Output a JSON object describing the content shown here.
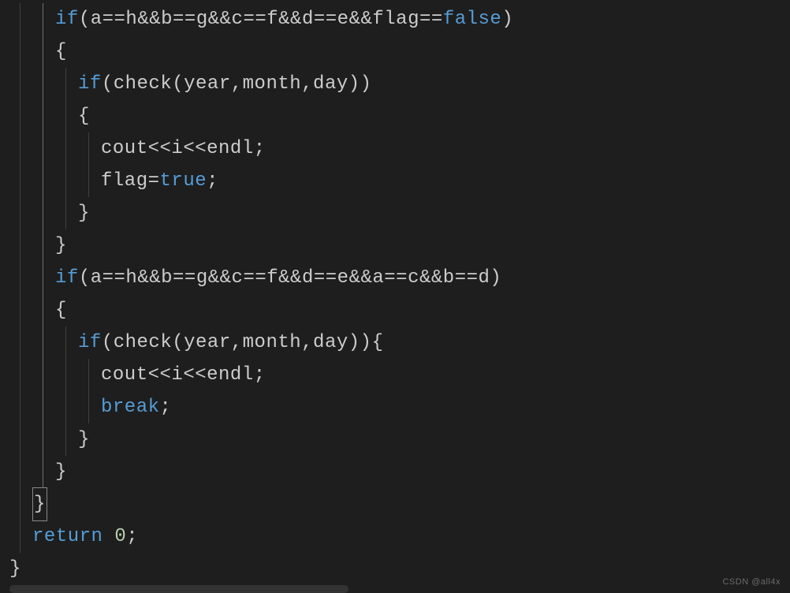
{
  "code": {
    "lines": [
      {
        "indent": 4,
        "tokens": [
          {
            "t": "if",
            "c": "keyword"
          },
          {
            "t": "(a==h&&b==g&&c==f&&d==e&&flag==",
            "c": "text"
          },
          {
            "t": "false",
            "c": "bool"
          },
          {
            "t": ")",
            "c": "text"
          }
        ]
      },
      {
        "indent": 4,
        "tokens": [
          {
            "t": "{",
            "c": "text"
          }
        ]
      },
      {
        "indent": 6,
        "tokens": [
          {
            "t": "if",
            "c": "keyword"
          },
          {
            "t": "(check(year,month,day))",
            "c": "text"
          }
        ]
      },
      {
        "indent": 6,
        "tokens": [
          {
            "t": "{",
            "c": "text"
          }
        ]
      },
      {
        "indent": 8,
        "tokens": [
          {
            "t": "cout<<i<<endl;",
            "c": "text"
          }
        ]
      },
      {
        "indent": 8,
        "tokens": [
          {
            "t": "flag=",
            "c": "text"
          },
          {
            "t": "true",
            "c": "bool"
          },
          {
            "t": ";",
            "c": "text"
          }
        ]
      },
      {
        "indent": 6,
        "tokens": [
          {
            "t": "}",
            "c": "text"
          }
        ]
      },
      {
        "indent": 4,
        "tokens": [
          {
            "t": "}",
            "c": "text"
          }
        ]
      },
      {
        "indent": 4,
        "tokens": [
          {
            "t": "if",
            "c": "keyword"
          },
          {
            "t": "(a==h&&b==g&&c==f&&d==e&&a==c&&b==d)",
            "c": "text"
          }
        ]
      },
      {
        "indent": 4,
        "tokens": [
          {
            "t": "{",
            "c": "text"
          }
        ]
      },
      {
        "indent": 6,
        "tokens": [
          {
            "t": "if",
            "c": "keyword"
          },
          {
            "t": "(check(year,month,day)){",
            "c": "text"
          }
        ]
      },
      {
        "indent": 8,
        "tokens": [
          {
            "t": "cout<<i<<endl;",
            "c": "text"
          }
        ]
      },
      {
        "indent": 8,
        "tokens": [
          {
            "t": "break",
            "c": "keyword"
          },
          {
            "t": ";",
            "c": "text"
          }
        ]
      },
      {
        "indent": 6,
        "tokens": [
          {
            "t": "}",
            "c": "text"
          }
        ]
      },
      {
        "indent": 4,
        "tokens": [
          {
            "t": "}",
            "c": "text"
          }
        ]
      },
      {
        "indent": 2,
        "tokens": [
          {
            "t": "}",
            "c": "text",
            "bracket": true
          }
        ]
      },
      {
        "indent": 2,
        "tokens": [
          {
            "t": "return",
            "c": "keyword"
          },
          {
            "t": " ",
            "c": "text"
          },
          {
            "t": "0",
            "c": "num"
          },
          {
            "t": ";",
            "c": "text"
          }
        ]
      },
      {
        "indent": 0,
        "tokens": [
          {
            "t": "}",
            "c": "text"
          }
        ]
      }
    ]
  },
  "watermark": "CSDN @all4x",
  "indentGuides": {
    "positions": [
      13,
      42,
      71,
      100,
      129
    ],
    "activeColumn": 1
  }
}
